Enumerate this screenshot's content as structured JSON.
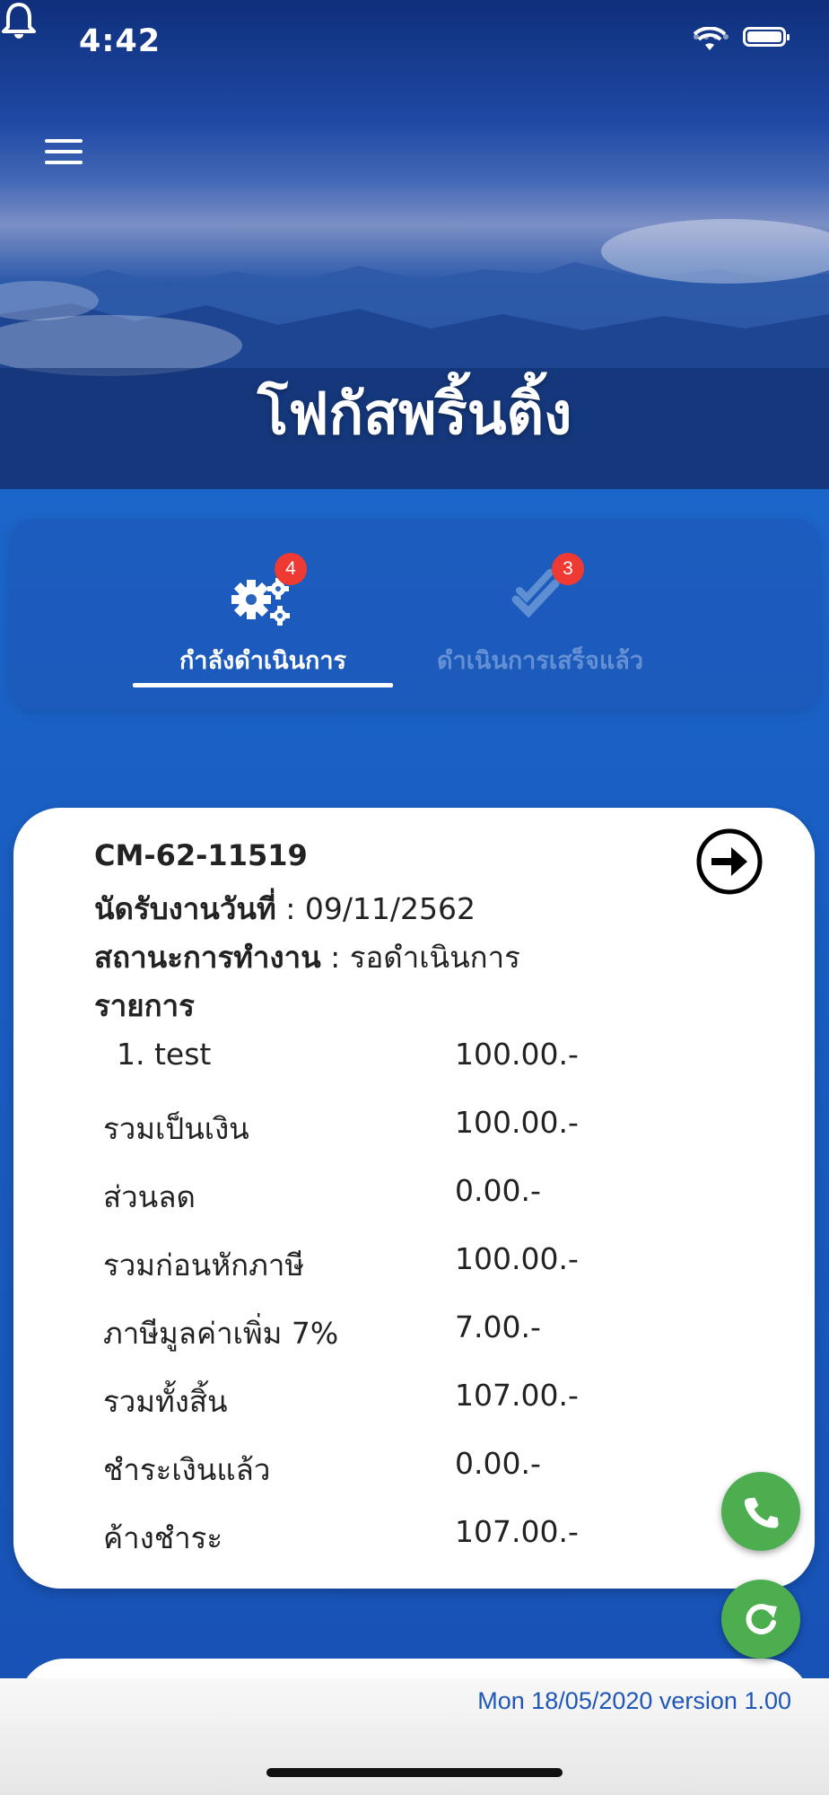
{
  "status_bar": {
    "time": "4:42"
  },
  "header": {
    "shop_name": "โฟกัสพริ้นติ้ง",
    "menu_icon": "hamburger-menu-icon",
    "notification_icon": "bell-icon"
  },
  "tabs": [
    {
      "label": "กำลังดำเนินการ",
      "badge": "4",
      "icon": "gears-icon",
      "active": true
    },
    {
      "label": "ดำเนินการเสร็จแล้ว",
      "badge": "3",
      "icon": "double-check-icon",
      "active": false
    }
  ],
  "job": {
    "id": "CM-62-11519",
    "appointment_label": "นัดรับงานวันที่",
    "appointment_value": ": 09/11/2562",
    "status_label": "สถานะการทำงาน",
    "status_value": ": รอดำเนินการ",
    "items_header": "รายการ",
    "rows": [
      {
        "label": "1. test",
        "value": "100.00.-"
      },
      {
        "label": "รวมเป็นเงิน",
        "value": "100.00.-"
      },
      {
        "label": "ส่วนลด",
        "value": "0.00.-"
      },
      {
        "label": "รวมก่อนหักภาษี",
        "value": "100.00.-"
      },
      {
        "label": "ภาษีมูลค่าเพิ่ม 7%",
        "value": "7.00.-"
      },
      {
        "label": "รวมทั้งสิ้น",
        "value": "107.00.-"
      },
      {
        "label": "ชำระเงินแล้ว",
        "value": "0.00.-"
      },
      {
        "label": "ค้างชำระ",
        "value": "107.00.-"
      }
    ]
  },
  "footer": {
    "text": "Mon 18/05/2020 version 1.00"
  },
  "colors": {
    "accent_green": "#4cae4f",
    "badge_red": "#ee3a32",
    "primary_blue": "#1f57b8"
  }
}
